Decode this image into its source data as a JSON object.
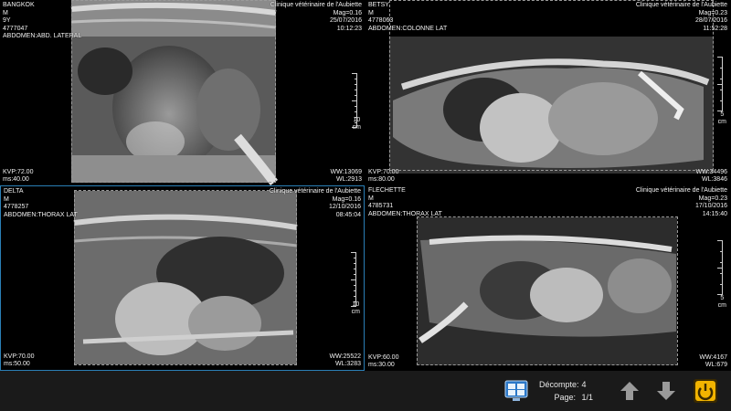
{
  "panes": [
    {
      "name": "BANGKOK",
      "patient_lines": [
        "BANGKOK",
        "M",
        "9Y",
        "4777047",
        "ABDOMEN:ABD. LATERAL"
      ],
      "clinic": "Clinique vétérinaire de l'Aubiette",
      "mag": "Mag=0.16",
      "date": "25/07/2016",
      "time": "10:12:23",
      "kvp": "KVP:72.00",
      "ms": "ms:40.00",
      "ww": "WW:13069",
      "wl": "WL:2913",
      "scale_label": [
        "10",
        "cm"
      ],
      "selected": false
    },
    {
      "name": "BETSY",
      "patient_lines": [
        "BETSY",
        "M",
        "4778063",
        "ABDOMEN:COLONNE LAT"
      ],
      "clinic": "Clinique vétérinaire de l'Aubiette",
      "mag": "Mag=0.23",
      "date": "28/07/2016",
      "time": "11:52:28",
      "kvp": "KVP:70.00",
      "ms": "ms:80.00",
      "ww": "WW:34496",
      "wl": "WL:3846",
      "scale_label": [
        "5",
        "cm"
      ],
      "selected": false
    },
    {
      "name": "DELTA",
      "patient_lines": [
        "DELTA",
        "M",
        "4778257",
        "ABDOMEN:THORAX LAT"
      ],
      "clinic": "Clinique vétérinaire de l'Aubiette",
      "mag": "Mag=0.16",
      "date": "12/10/2016",
      "time": "08:45:04",
      "kvp": "KVP:70.00",
      "ms": "ms:50.00",
      "ww": "WW:25522",
      "wl": "WL:3283",
      "scale_label": [
        "10",
        "cm"
      ],
      "selected": true
    },
    {
      "name": "FLECHETTE",
      "patient_lines": [
        "FLECHETTE",
        "M",
        "4785731",
        "ABDOMEN:THORAX LAT"
      ],
      "clinic": "Clinique vétérinaire de l'Aubiette",
      "mag": "Mag=0.23",
      "date": "17/10/2016",
      "time": "14:15:40",
      "kvp": "KVP:60.00",
      "ms": "ms:30.00",
      "ww": "WW:4167",
      "wl": "WL:679",
      "scale_label": [
        "5",
        "cm"
      ],
      "selected": false
    }
  ],
  "toolbar": {
    "count_label": "Décompte:",
    "count_value": "4",
    "page_label": "Page:",
    "page_value": "1/1",
    "icons": {
      "layout": "grid-layout-icon",
      "up": "arrow-up-icon",
      "down": "arrow-down-icon",
      "power": "power-icon"
    }
  },
  "colors": {
    "selection_border": "#2a7fb6",
    "toolbar_bg": "#1a1a1a",
    "power_accent": "#e8a400",
    "layout_accent": "#2b78c8"
  }
}
